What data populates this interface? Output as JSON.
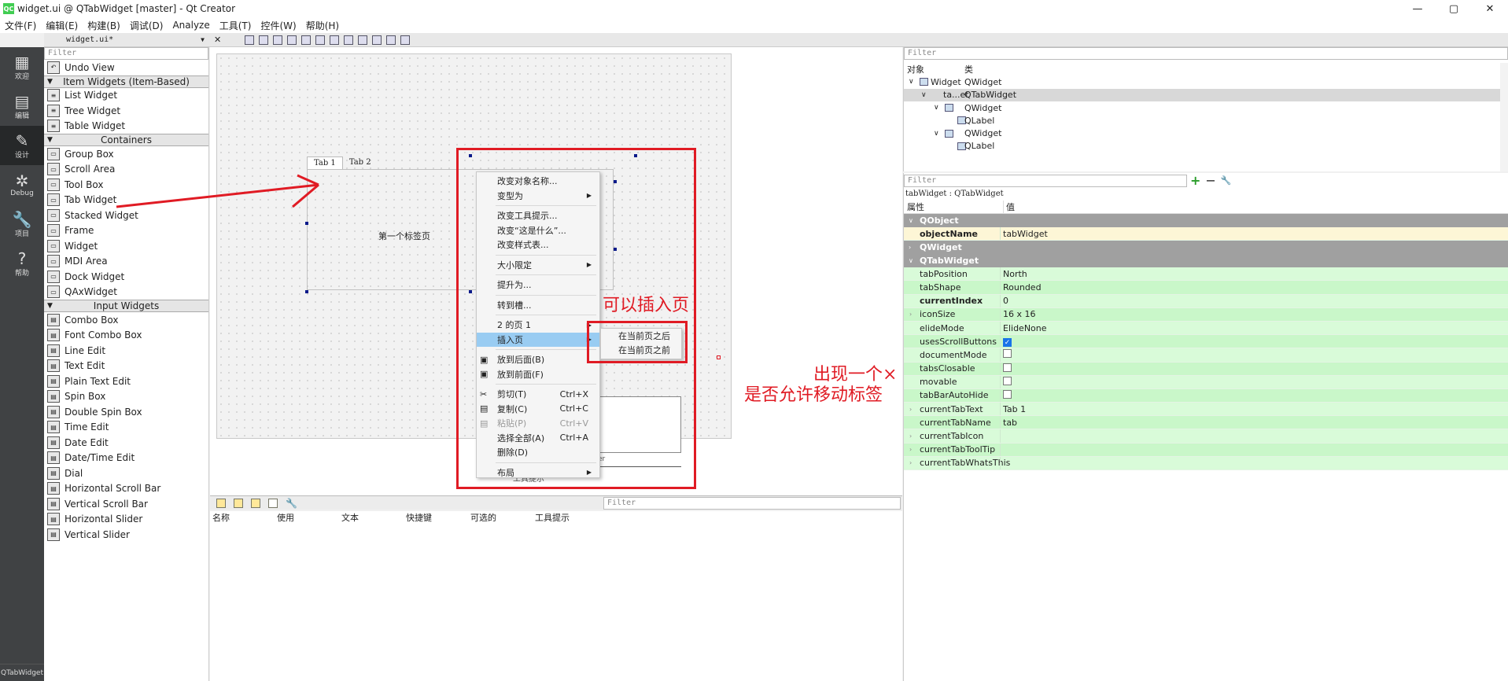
{
  "window": {
    "title": "widget.ui @ QTabWidget [master] - Qt Creator",
    "logo": "QC",
    "controls": [
      "—",
      "▢",
      "✕"
    ]
  },
  "menu": [
    "文件(F)",
    "编辑(E)",
    "构建(B)",
    "调试(D)",
    "Analyze",
    "工具(T)",
    "控件(W)",
    "帮助(H)"
  ],
  "modes": [
    {
      "label": "欢迎",
      "icon": "grid-icon"
    },
    {
      "label": "编辑",
      "icon": "document-icon"
    },
    {
      "label": "设计",
      "icon": "pencil-icon"
    },
    {
      "label": "Debug",
      "icon": "bug-icon"
    },
    {
      "label": "项目",
      "icon": "wrench-icon"
    },
    {
      "label": "帮助",
      "icon": "help-icon"
    }
  ],
  "modebar_bottom": "QTabWidget",
  "editor": {
    "document": "widget.ui*",
    "close": "✕"
  },
  "widgetbox": {
    "filter_placeholder": "Filter",
    "undo_view": "Undo View",
    "item_widgets_title": "Item Widgets (Item-Based)",
    "item_widgets": [
      "List Widget",
      "Tree Widget",
      "Table Widget"
    ],
    "containers_title": "Containers",
    "containers": [
      "Group Box",
      "Scroll Area",
      "Tool Box",
      "Tab Widget",
      "Stacked Widget",
      "Frame",
      "Widget",
      "MDI Area",
      "Dock Widget",
      "QAxWidget"
    ],
    "input_title": "Input Widgets",
    "inputs": [
      "Combo Box",
      "Font Combo Box",
      "Line Edit",
      "Text Edit",
      "Plain Text Edit",
      "Spin Box",
      "Double Spin Box",
      "Time Edit",
      "Date Edit",
      "Date/Time Edit",
      "Dial",
      "Horizontal Scroll Bar",
      "Vertical Scroll Bar",
      "Horizontal Slider",
      "Vertical Slider"
    ]
  },
  "canvas": {
    "tabs": [
      "Tab 1",
      "Tab 2"
    ],
    "page_label": "第一个标签页",
    "partial_text_1": "er",
    "partial_text_2": "工具提示"
  },
  "context_menu": {
    "items": [
      {
        "label": "改变对象名称...",
        "sep_after": false
      },
      {
        "label": "变型为",
        "sub": true,
        "sep_after": true
      },
      {
        "label": "改变工具提示...",
        "sep_after": false
      },
      {
        "label": "改变“这是什么”...",
        "sep_after": false
      },
      {
        "label": "改变样式表...",
        "sep_after": true
      },
      {
        "label": "大小限定",
        "sub": true,
        "sep_after": true
      },
      {
        "label": "提升为...",
        "sep_after": true
      },
      {
        "label": "转到槽...",
        "sep_after": true
      },
      {
        "label": "2 的页 1",
        "sub": true,
        "sep_after": false
      },
      {
        "label": "插入页",
        "sub": true,
        "selected": true,
        "sep_after": true
      },
      {
        "label": "放到后面(B)",
        "sep_after": false
      },
      {
        "label": "放到前面(F)",
        "sep_after": true
      },
      {
        "label": "剪切(T)",
        "shortcut": "Ctrl+X",
        "sep_after": false
      },
      {
        "label": "复制(C)",
        "shortcut": "Ctrl+C",
        "sep_after": false
      },
      {
        "label": "粘贴(P)",
        "shortcut": "Ctrl+V",
        "disabled": true,
        "sep_after": false
      },
      {
        "label": "选择全部(A)",
        "shortcut": "Ctrl+A",
        "sep_after": false
      },
      {
        "label": "删除(D)",
        "sep_after": true
      },
      {
        "label": "布局",
        "sub": true,
        "sep_after": false
      }
    ],
    "submenu": [
      "在当前页之后",
      "在当前页之前"
    ]
  },
  "annotations": {
    "insert_page": "可以插入页",
    "closable": "出现一个×",
    "movable": "是否允许移动标签"
  },
  "action_editor": {
    "filter_placeholder": "Filter",
    "columns": [
      "名称",
      "使用",
      "文本",
      "快捷键",
      "可选的",
      "工具提示"
    ]
  },
  "object_inspector": {
    "filter_placeholder": "Filter",
    "col_object": "对象",
    "col_class": "类",
    "rows": [
      {
        "object": "Widget",
        "class": "QWidget",
        "indent": 0,
        "expand": "open"
      },
      {
        "object": "ta...et",
        "class": "QTabWidget",
        "indent": 1,
        "expand": "open",
        "highlight": true
      },
      {
        "object": "",
        "class": "QWidget",
        "indent": 2,
        "expand": "open"
      },
      {
        "object": "",
        "class": "QLabel",
        "indent": 3,
        "expand": ""
      },
      {
        "object": "",
        "class": "QWidget",
        "indent": 2,
        "expand": "open"
      },
      {
        "object": "",
        "class": "QLabel",
        "indent": 3,
        "expand": ""
      }
    ]
  },
  "property_editor": {
    "filter_placeholder": "Filter",
    "subject": "tabWidget : QTabWidget",
    "col_prop": "属性",
    "col_value": "值",
    "groups": [
      {
        "name": "QObject",
        "props": [
          {
            "name": "objectName",
            "value": "tabWidget",
            "bold": true,
            "bg": "#fdf6d6"
          }
        ]
      },
      {
        "name": "QWidget",
        "collapsed": true,
        "props": []
      },
      {
        "name": "QTabWidget",
        "props": [
          {
            "name": "tabPosition",
            "value": "North"
          },
          {
            "name": "tabShape",
            "value": "Rounded"
          },
          {
            "name": "currentIndex",
            "value": "0",
            "bold": true
          },
          {
            "name": "iconSize",
            "value": "16 x 16",
            "expandable": true
          },
          {
            "name": "elideMode",
            "value": "ElideNone"
          },
          {
            "name": "usesScrollButtons",
            "check": true
          },
          {
            "name": "documentMode",
            "check": false
          },
          {
            "name": "tabsClosable",
            "check": false
          },
          {
            "name": "movable",
            "check": false
          },
          {
            "name": "tabBarAutoHide",
            "check": false
          },
          {
            "name": "currentTabText",
            "value": "Tab 1",
            "expandable": true
          },
          {
            "name": "currentTabName",
            "value": "tab"
          },
          {
            "name": "currentTabIcon",
            "value": "",
            "expandable": true
          },
          {
            "name": "currentTabToolTip",
            "value": "",
            "expandable": true
          },
          {
            "name": "currentTabWhatsThis",
            "value": "",
            "expandable": true
          }
        ]
      }
    ]
  },
  "colors": {
    "red": "#e01b24",
    "prop_bg": "#c9f7c9",
    "prop_bg_alt": "#d9fbd9",
    "selection": "#99ccf2"
  }
}
